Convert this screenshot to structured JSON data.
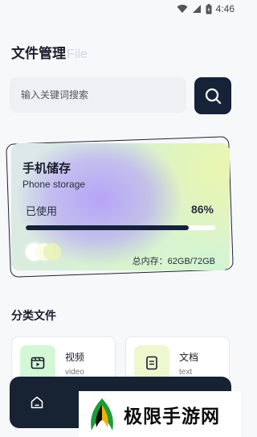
{
  "status_bar": {
    "time": "4:46",
    "icons": [
      "wifi-icon",
      "signal-icon",
      "battery-icon"
    ]
  },
  "header": {
    "title": "文件管理",
    "title_en": "File"
  },
  "search": {
    "placeholder": "输入关键词搜索",
    "button_icon": "search-icon"
  },
  "storage": {
    "title": "手机储存",
    "subtitle": "Phone storage",
    "used_label": "已使用",
    "used_percent": "86%",
    "used_fraction": 0.86,
    "total_text": "总内存：62GB/72GB"
  },
  "categories": {
    "title": "分类文件",
    "items": [
      {
        "name": "视频",
        "en": "video",
        "icon": "video-icon"
      },
      {
        "name": "文档",
        "en": "text",
        "icon": "document-icon"
      }
    ]
  },
  "bottom_nav": {
    "items": [
      "home-icon",
      "nav-icon-2",
      "nav-icon-3",
      "nav-icon-4"
    ]
  },
  "watermark": {
    "text": "极限手游网"
  },
  "colors": {
    "accent_dark": "#152238",
    "video_bg": "#d4f7d6",
    "doc_bg": "#eef8cf",
    "card_purple": "#b4a0fa",
    "card_lime": "#e8f6b0"
  }
}
